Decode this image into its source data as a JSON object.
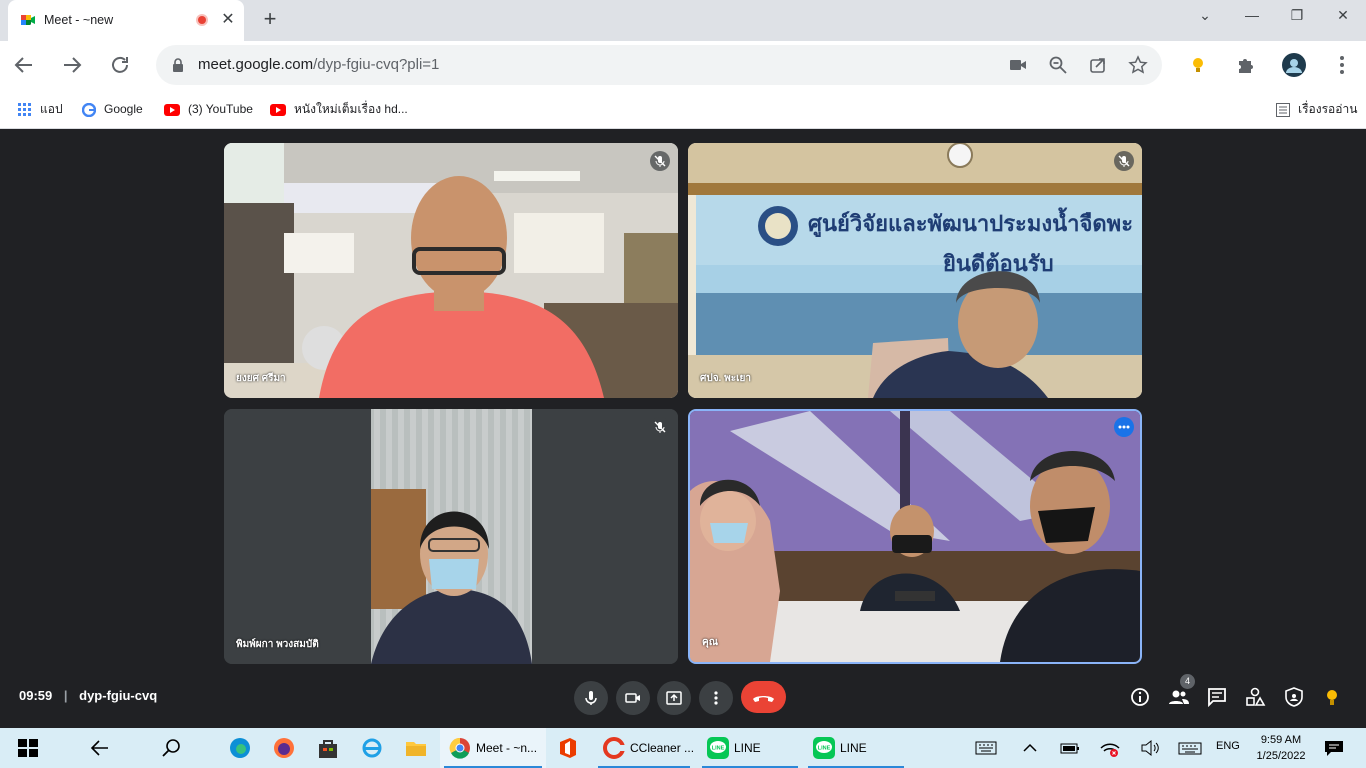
{
  "browser": {
    "tab_title": "Meet - ~new",
    "url_host": "meet.google.com",
    "url_path": "/dyp-fgiu-cvq?pli=1",
    "bookmarks": [
      {
        "label": "แอป",
        "icon": "apps-grid-icon"
      },
      {
        "label": "Google",
        "icon": "google-icon"
      },
      {
        "label": "(3) YouTube",
        "icon": "youtube-icon"
      },
      {
        "label": "หนังใหม่เต็มเรื่อง hd...",
        "icon": "youtube-icon"
      }
    ],
    "reading_list_label": "เรื่องรออ่าน"
  },
  "meet": {
    "clock": "09:59",
    "meeting_code": "dyp-fgiu-cvq",
    "participant_count": "4",
    "tiles": [
      {
        "name": "ยงยศ ศรีมา",
        "muted": true
      },
      {
        "name": "ศปจ. พะเยา",
        "muted": true
      },
      {
        "name": "พิมพ์ผกา พวงสมบัติ",
        "muted": true
      },
      {
        "name": "คุณ",
        "muted": false
      }
    ],
    "banner_text_line1": "ศูนย์วิจัยและพัฒนาประมงน้ำจืดพะ",
    "banner_text_line2": "ยินดีต้อนรับ"
  },
  "taskbar": {
    "apps": [
      {
        "label": "Meet - ~n...",
        "icon": "chrome-icon"
      },
      {
        "label": "",
        "icon": "office-icon"
      },
      {
        "label": "CCleaner ...",
        "icon": "ccleaner-icon"
      },
      {
        "label": "LINE",
        "icon": "line-icon"
      },
      {
        "label": "LINE",
        "icon": "line-icon"
      }
    ],
    "language": "ENG",
    "time": "9:59 AM",
    "date": "1/25/2022"
  },
  "colors": {
    "meet_bg": "#202124",
    "end_call": "#ea4335",
    "taskbar": "#d9edf6",
    "active_tile_border": "#8ab4f8"
  }
}
